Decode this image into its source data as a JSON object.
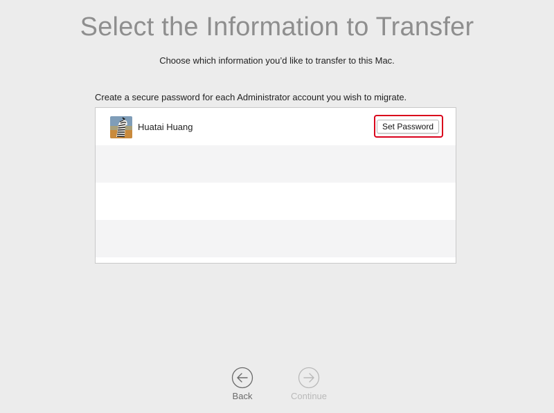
{
  "header": {
    "title": "Select the Information to Transfer",
    "subtitle": "Choose which information you’d like to transfer to this Mac."
  },
  "instruction": "Create a secure password for each Administrator account you wish to migrate.",
  "accounts": [
    {
      "name": "Huatai Huang",
      "avatar_icon": "zebra-avatar-icon",
      "button_label": "Set Password"
    }
  ],
  "navigation": {
    "back_label": "Back",
    "continue_label": "Continue",
    "continue_enabled": false
  },
  "colors": {
    "background": "#ececec",
    "title": "#8e8e8e",
    "highlight": "#d9001b",
    "row_alt": "#f4f4f5"
  }
}
